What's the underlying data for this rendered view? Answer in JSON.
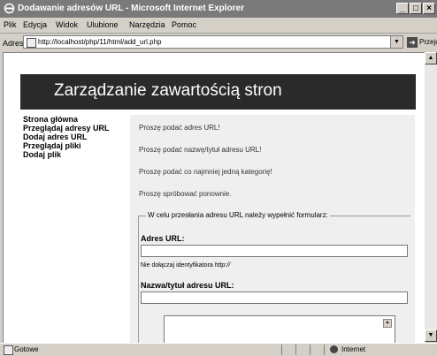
{
  "window": {
    "title": "Dodawanie adresów URL - Microsoft Internet Explorer"
  },
  "menu": [
    "Plik",
    "Edycja",
    "Widok",
    "Ulubione",
    "Narzędzia",
    "Pomoc"
  ],
  "address": {
    "label": "Adres",
    "url": "http://localhost/php/11/html/add_url.php",
    "go_label": "Przejdź"
  },
  "page": {
    "banner_title": "Zarządzanie zawartością stron",
    "nav": [
      "Strona główna",
      "Przeglądaj adresy URL",
      "Dodaj adres URL",
      "Przeglądaj pliki",
      "Dodaj plik"
    ],
    "messages": [
      "Proszę podać adres URL!",
      "Proszę podać nazwę/tytuł adresu URL!",
      "Proszę podać co najmniej jedną kategorię!",
      "Proszę spróbować ponownie."
    ],
    "form": {
      "legend": "W celu przesłania adresu URL należy wypełnić formularz:",
      "url_label": "Adres URL:",
      "url_value": "",
      "hint_prefix": "Nie dołączaj identyfikatora ",
      "hint_emph": "http://",
      "title_label": "Nazwa/tytuł adresu URL:",
      "title_value": ""
    }
  },
  "status": {
    "text": "Gotowe",
    "zone": "Internet"
  },
  "icons": [
    "ie-icon",
    "minimize-icon",
    "maximize-icon",
    "close-icon",
    "page-icon",
    "go-arrow-icon",
    "globe-icon"
  ]
}
